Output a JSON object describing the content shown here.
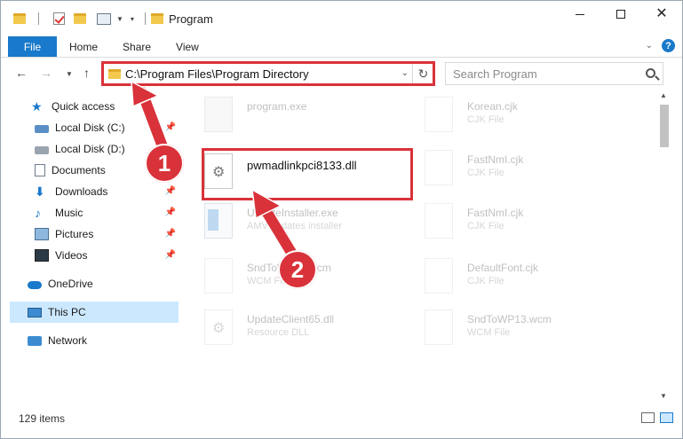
{
  "window": {
    "title": "Program",
    "minimize_glyph": "",
    "maximize_glyph": "",
    "close_glyph": "✕"
  },
  "ribbon": {
    "tabs": [
      {
        "label": "File"
      },
      {
        "label": "Home"
      },
      {
        "label": "Share"
      },
      {
        "label": "View"
      }
    ],
    "help": "?"
  },
  "address": {
    "path": "C:\\Program Files\\Program Directory",
    "refresh_glyph": "↻"
  },
  "search": {
    "placeholder": "Search Program"
  },
  "sidebar": {
    "items": [
      {
        "label": "Quick access",
        "icon": "star-icon",
        "pinned": false
      },
      {
        "label": "Local Disk (C:)",
        "icon": "disk-c-icon",
        "pinned": true
      },
      {
        "label": "Local Disk (D:)",
        "icon": "disk-d-icon",
        "pinned": false
      },
      {
        "label": "Documents",
        "icon": "documents-icon",
        "pinned": true
      },
      {
        "label": "Downloads",
        "icon": "downloads-icon",
        "pinned": true
      },
      {
        "label": "Music",
        "icon": "music-icon",
        "pinned": true
      },
      {
        "label": "Pictures",
        "icon": "pictures-icon",
        "pinned": true
      },
      {
        "label": "Videos",
        "icon": "videos-icon",
        "pinned": true
      },
      {
        "label": "OneDrive",
        "icon": "onedrive-icon",
        "pinned": false
      },
      {
        "label": "This PC",
        "icon": "this-pc-icon",
        "pinned": false,
        "selected": true
      },
      {
        "label": "Network",
        "icon": "network-icon",
        "pinned": false
      }
    ]
  },
  "files": {
    "left": [
      {
        "name": "program.exe",
        "type": ""
      },
      {
        "name": "pwmadlinkpci8133.dll",
        "type": ""
      },
      {
        "name": "UpdateInstaller.exe",
        "type": "AMV updates installer"
      },
      {
        "name": "SndToWP13.wcm",
        "type": "WCM File"
      },
      {
        "name": "UpdateClient65.dll",
        "type": "Resource DLL"
      }
    ],
    "right": [
      {
        "name": "Korean.cjk",
        "type": "CJK File"
      },
      {
        "name": "FastNmI.cjk",
        "type": "CJK File"
      },
      {
        "name": "FastNmI.cjk",
        "type": "CJK File"
      },
      {
        "name": "DefaultFont.cjk",
        "type": "CJK File"
      },
      {
        "name": "SndToWP13.wcm",
        "type": "WCM File"
      }
    ]
  },
  "status": {
    "count": "129 items"
  },
  "callouts": {
    "one": "1",
    "two": "2"
  },
  "colors": {
    "accent": "#1979ca",
    "annotation_red": "#d9323a",
    "selection": "#cce8ff"
  }
}
